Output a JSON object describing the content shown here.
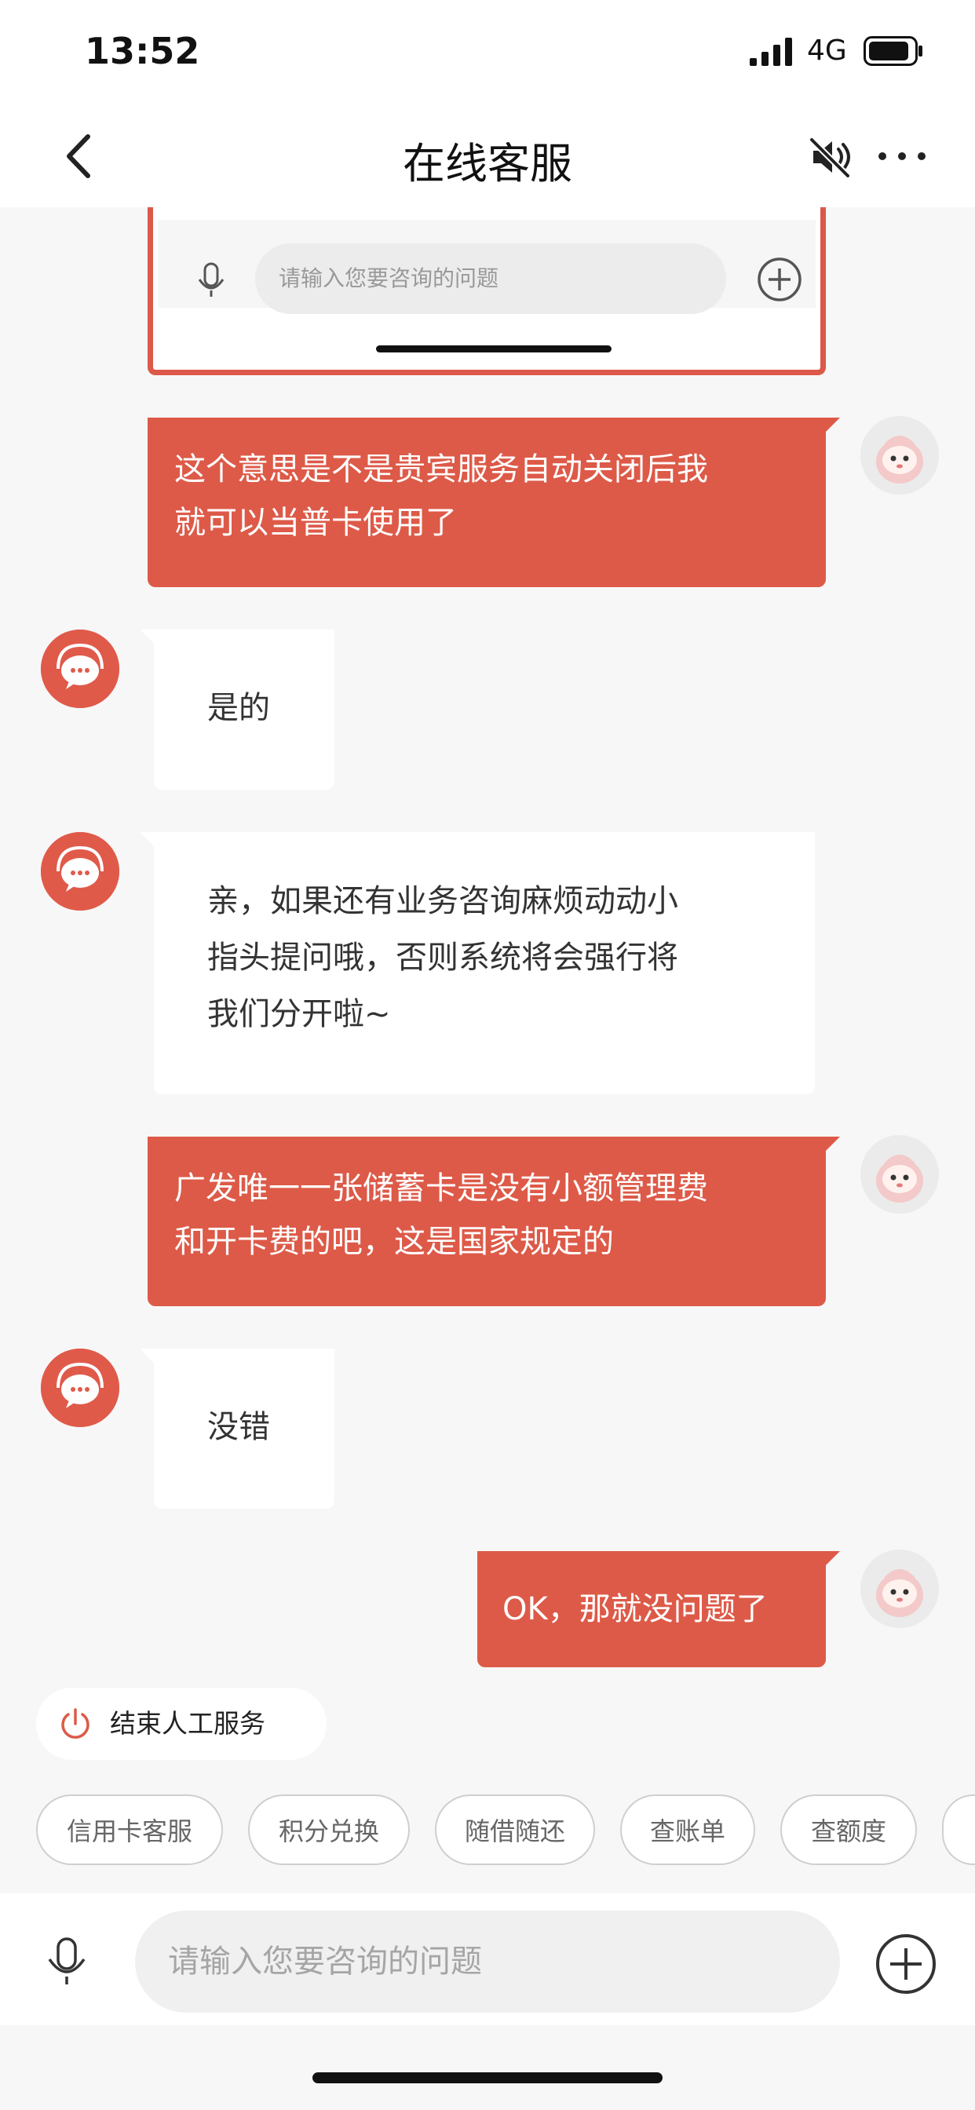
{
  "status": {
    "time": "13:52",
    "network": "4G"
  },
  "nav": {
    "title": "在线客服"
  },
  "screenshot": {
    "input_placeholder": "请输入您要咨询的问题"
  },
  "messages": [
    {
      "from": "user",
      "lines": [
        "这个意思是不是贵宾服务自动关闭后我",
        "就可以当普卡使用了"
      ]
    },
    {
      "from": "agent",
      "lines": [
        "是的"
      ]
    },
    {
      "from": "agent",
      "lines": [
        "亲，如果还有业务咨询麻烦动动小",
        "指头提问哦，否则系统将会强行将",
        "我们分开啦~"
      ]
    },
    {
      "from": "user",
      "lines": [
        "广发唯一一张储蓄卡是没有小额管理费",
        "和开卡费的吧，这是国家规定的"
      ]
    },
    {
      "from": "agent",
      "lines": [
        "没错"
      ]
    },
    {
      "from": "user",
      "lines": [
        "OK，那就没问题了"
      ]
    }
  ],
  "end_service": {
    "label": "结束人工服务"
  },
  "quick_actions": [
    "信用卡客服",
    "积分兑换",
    "随借随还",
    "查账单",
    "查额度"
  ],
  "input": {
    "placeholder": "请输入您要咨询的问题"
  },
  "colors": {
    "accent": "#dd5a48",
    "background": "#f7f7f7"
  }
}
